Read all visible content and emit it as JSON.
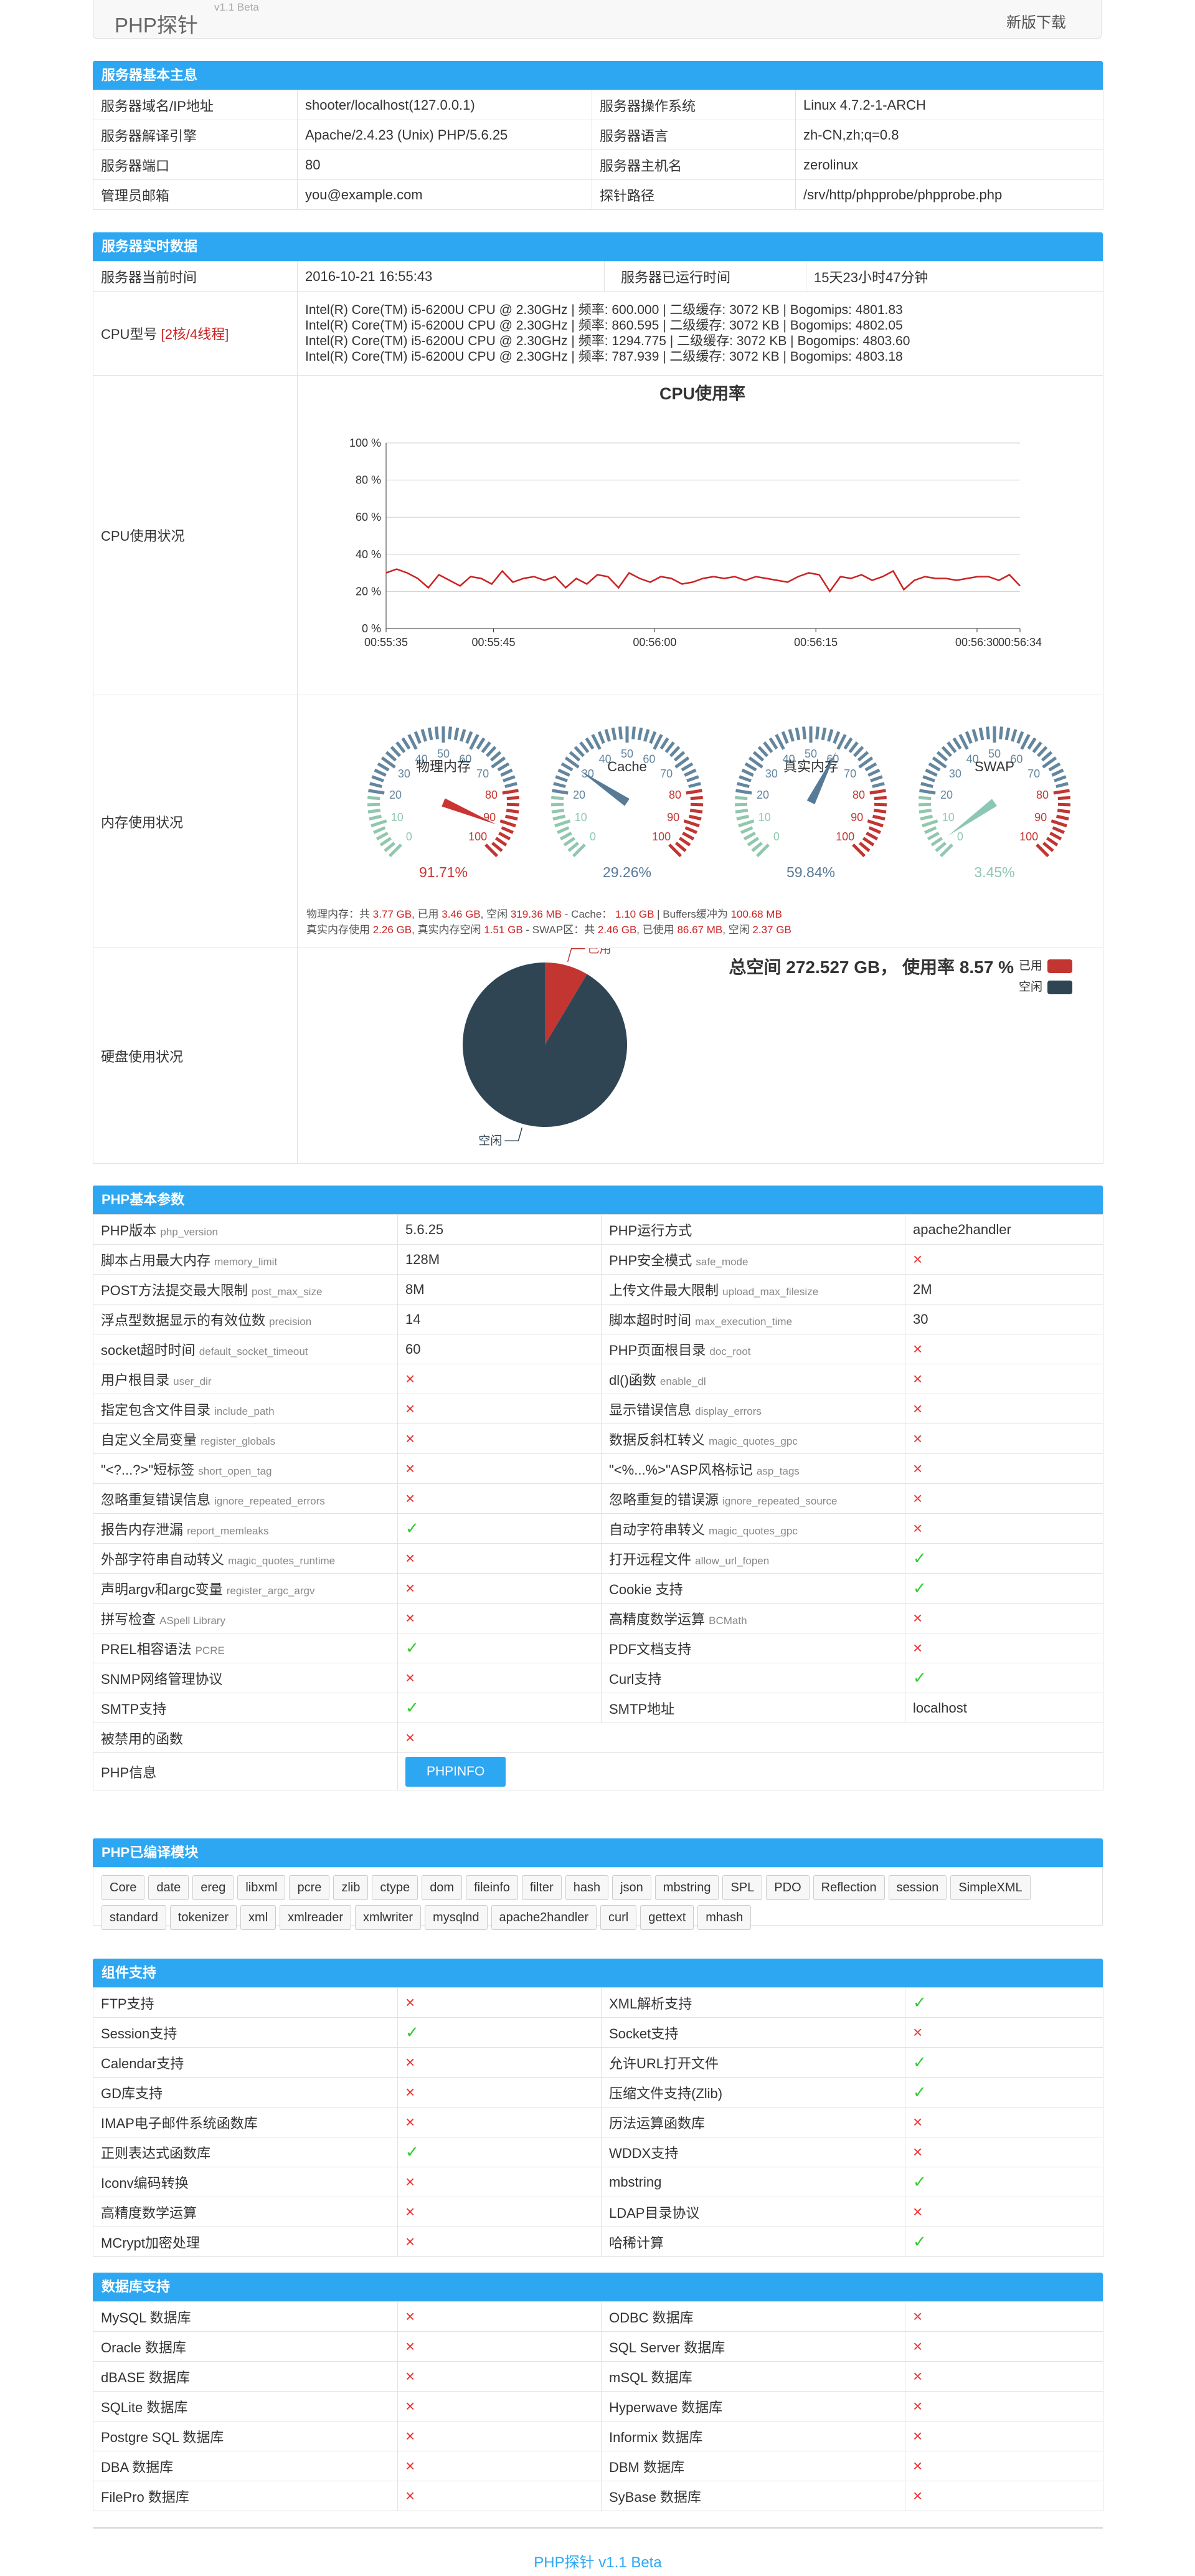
{
  "nav": {
    "brand": "PHP探针",
    "version": "v1.1 Beta",
    "download": "新版下载"
  },
  "server_info": {
    "title": "服务器基本主息",
    "rows": [
      [
        "服务器域名/IP地址",
        "shooter/localhost(127.0.0.1)",
        "服务器操作系统",
        "Linux 4.7.2-1-ARCH"
      ],
      [
        "服务器解译引擎",
        "Apache/2.4.23 (Unix) PHP/5.6.25",
        "服务器语言",
        "zh-CN,zh;q=0.8"
      ],
      [
        "服务器端口",
        "80",
        "服务器主机名",
        "zerolinux"
      ],
      [
        "管理员邮箱",
        "you@example.com",
        "探针路径",
        "/srv/http/phpprobe/phpprobe.php"
      ]
    ]
  },
  "realtime": {
    "title": "服务器实时数据",
    "time_label": "服务器当前时间",
    "time_value": "2016-10-21 16:55:43",
    "uptime_label": "服务器已运行时间",
    "uptime_value": "15天23小时47分钟",
    "cpu_label": "CPU型号",
    "cpu_cores": "[2核/4线程]",
    "cpu_lines": [
      "Intel(R) Core(TM) i5-6200U CPU @ 2.30GHz | 频率: 600.000 | 二级缓存: 3072 KB | Bogomips: 4801.83",
      "Intel(R) Core(TM) i5-6200U CPU @ 2.30GHz | 频率: 860.595 | 二级缓存: 3072 KB | Bogomips: 4802.05",
      "Intel(R) Core(TM) i5-6200U CPU @ 2.30GHz | 频率: 1294.775 | 二级缓存: 3072 KB | Bogomips: 4803.60",
      "Intel(R) Core(TM) i5-6200U CPU @ 2.30GHz | 频率: 787.939 | 二级缓存: 3072 KB | Bogomips: 4803.18"
    ],
    "cpu_usage_label": "CPU使用状况",
    "mem_usage_label": "内存使用状况",
    "disk_usage_label": "硬盘使用状况",
    "mem_line1": {
      "a": "物理内存：共 ",
      "b": "3.77 GB",
      "c": ", 已用 ",
      "d": "3.46 GB",
      "e": ", 空闲 ",
      "f": "319.36 MB",
      "g": " - Cache：  ",
      "h": "1.10 GB",
      "i": " | Buffers缓冲为 ",
      "j": "100.68 MB"
    },
    "mem_line2": {
      "a": "真实内存使用 ",
      "b": "2.26 GB",
      "c": ", 真实内存空闲 ",
      "d": "1.51 GB",
      "e": " - SWAP区：共 ",
      "f": "2.46 GB",
      "g": ", 已使用 ",
      "h": "86.67 MB",
      "i": ", 空闲 ",
      "j": "2.37 GB"
    }
  },
  "chart_data": [
    {
      "type": "line",
      "title": "CPU使用率",
      "x_ticks": [
        "00:55:35",
        "00:55:45",
        "00:56:00",
        "00:56:15",
        "00:56:30",
        "00:56:34"
      ],
      "y_ticks": [
        "0 %",
        "20 %",
        "40 %",
        "60 %",
        "80 %",
        "100 %"
      ],
      "ylim": [
        0,
        100
      ],
      "xlim": [
        "00:55:35",
        "00:56:34"
      ],
      "grid": true,
      "color": "#cc2222",
      "series": [
        {
          "values": [
            30,
            32,
            30,
            27,
            22,
            29,
            26,
            23,
            28,
            27,
            24,
            31,
            25,
            27,
            28,
            26,
            28,
            22,
            27,
            24,
            29,
            28,
            22,
            30,
            27,
            25,
            28,
            27,
            24,
            25,
            27,
            28,
            27,
            28,
            26,
            28,
            27,
            26,
            25,
            28,
            30,
            29,
            20,
            28,
            27,
            29,
            26,
            28,
            31,
            21,
            26,
            28,
            27,
            27,
            26,
            27,
            28,
            28,
            26,
            29,
            23
          ]
        }
      ]
    },
    {
      "type": "gauge",
      "gauges": [
        {
          "name": "物理内存",
          "value": 91.71,
          "label": "91.71%",
          "color": "#cc3333"
        },
        {
          "name": "Cache",
          "value": 29.26,
          "label": "29.26%",
          "color": "#577a97"
        },
        {
          "name": "真实内存",
          "value": 59.84,
          "label": "59.84%",
          "color": "#577a97"
        },
        {
          "name": "SWAP",
          "value": 3.45,
          "label": "3.45%",
          "color": "#8cc7b5"
        }
      ],
      "ticks": [
        "0",
        "10",
        "20",
        "30",
        "40",
        "50",
        "60",
        "70",
        "80",
        "90",
        "100"
      ]
    },
    {
      "type": "pie",
      "title": "总空间 272.527 GB， 使用率 8.57 %",
      "slices": [
        {
          "name": "已用",
          "value": 8.57,
          "color": "#c23531"
        },
        {
          "name": "空闲",
          "value": 91.43,
          "color": "#2f4554"
        }
      ],
      "legend_position": "top-right"
    }
  ],
  "php_basic": {
    "title": "PHP基本参数",
    "rows": [
      [
        [
          "PHP版本 ",
          "php_version"
        ],
        [
          "5.6.25",
          ""
        ],
        [
          "PHP运行方式",
          ""
        ],
        [
          "apache2handler",
          ""
        ]
      ],
      [
        [
          "脚本占用最大内存 ",
          "memory_limit"
        ],
        [
          "128M",
          ""
        ],
        [
          "PHP安全模式 ",
          "safe_mode"
        ],
        [
          "×",
          "x"
        ]
      ],
      [
        [
          "POST方法提交最大限制 ",
          "post_max_size"
        ],
        [
          "8M",
          ""
        ],
        [
          "上传文件最大限制 ",
          "upload_max_filesize"
        ],
        [
          "2M",
          ""
        ]
      ],
      [
        [
          "浮点型数据显示的有效位数 ",
          "precision"
        ],
        [
          "14",
          ""
        ],
        [
          "脚本超时时间 ",
          "max_execution_time"
        ],
        [
          "30",
          ""
        ]
      ],
      [
        [
          "socket超时时间 ",
          "default_socket_timeout"
        ],
        [
          "60",
          ""
        ],
        [
          "PHP页面根目录 ",
          "doc_root"
        ],
        [
          "×",
          "x"
        ]
      ],
      [
        [
          "用户根目录 ",
          "user_dir"
        ],
        [
          "×",
          "x"
        ],
        [
          "dl()函数 ",
          "enable_dl"
        ],
        [
          "×",
          "x"
        ]
      ],
      [
        [
          "指定包含文件目录 ",
          "include_path"
        ],
        [
          "×",
          "x"
        ],
        [
          "显示错误信息 ",
          "display_errors"
        ],
        [
          "×",
          "x"
        ]
      ],
      [
        [
          "自定义全局变量 ",
          "register_globals"
        ],
        [
          "×",
          "x"
        ],
        [
          "数据反斜杠转义 ",
          "magic_quotes_gpc"
        ],
        [
          "×",
          "x"
        ]
      ],
      [
        [
          "\"<?...?>\"短标签 ",
          "short_open_tag"
        ],
        [
          "×",
          "x"
        ],
        [
          "\"<%...%>\"ASP风格标记 ",
          "asp_tags"
        ],
        [
          "×",
          "x"
        ]
      ],
      [
        [
          "忽略重复错误信息 ",
          "ignore_repeated_errors"
        ],
        [
          "×",
          "x"
        ],
        [
          "忽略重复的错误源 ",
          "ignore_repeated_source"
        ],
        [
          "×",
          "x"
        ]
      ],
      [
        [
          "报告内存泄漏 ",
          "report_memleaks"
        ],
        [
          "✓",
          "ok"
        ],
        [
          "自动字符串转义 ",
          "magic_quotes_gpc"
        ],
        [
          "×",
          "x"
        ]
      ],
      [
        [
          "外部字符串自动转义 ",
          "magic_quotes_runtime"
        ],
        [
          "×",
          "x"
        ],
        [
          "打开远程文件 ",
          "allow_url_fopen"
        ],
        [
          "✓",
          "ok"
        ]
      ],
      [
        [
          "声明argv和argc变量 ",
          "register_argc_argv"
        ],
        [
          "×",
          "x"
        ],
        [
          "Cookie 支持",
          ""
        ],
        [
          "✓",
          "ok"
        ]
      ],
      [
        [
          "拼写检查 ",
          "ASpell Library"
        ],
        [
          "×",
          "x"
        ],
        [
          "高精度数学运算 ",
          "BCMath"
        ],
        [
          "×",
          "x"
        ]
      ],
      [
        [
          "PREL相容语法 ",
          "PCRE"
        ],
        [
          "✓",
          "ok"
        ],
        [
          "PDF文档支持",
          ""
        ],
        [
          "×",
          "x"
        ]
      ],
      [
        [
          "SNMP网络管理协议",
          ""
        ],
        [
          "×",
          "x"
        ],
        [
          "Curl支持",
          ""
        ],
        [
          "✓",
          "ok"
        ]
      ],
      [
        [
          "SMTP支持",
          ""
        ],
        [
          "✓",
          "ok"
        ],
        [
          "SMTP地址",
          ""
        ],
        [
          "localhost",
          ""
        ]
      ]
    ],
    "disabled_label": "被禁用的函数",
    "disabled_value": "×",
    "phpinfo_label": "PHP信息",
    "phpinfo_button": "PHPINFO"
  },
  "modules": {
    "title": "PHP已编译模块",
    "items": [
      "Core",
      "date",
      "ereg",
      "libxml",
      "pcre",
      "zlib",
      "ctype",
      "dom",
      "fileinfo",
      "filter",
      "hash",
      "json",
      "mbstring",
      "SPL",
      "PDO",
      "Reflection",
      "session",
      "SimpleXML",
      "standard",
      "tokenizer",
      "xml",
      "xmlreader",
      "xmlwriter",
      "mysqlnd",
      "apache2handler",
      "curl",
      "gettext",
      "mhash"
    ]
  },
  "components": {
    "title": "组件支持",
    "rows": [
      [
        "FTP支持",
        "x",
        "XML解析支持",
        "ok"
      ],
      [
        "Session支持",
        "ok",
        "Socket支持",
        "x"
      ],
      [
        "Calendar支持",
        "x",
        "允许URL打开文件",
        "ok"
      ],
      [
        "GD库支持",
        "x",
        "压缩文件支持(Zlib)",
        "ok"
      ],
      [
        "IMAP电子邮件系统函数库",
        "x",
        "历法运算函数库",
        "x"
      ],
      [
        "正则表达式函数库",
        "ok",
        "WDDX支持",
        "x"
      ],
      [
        "Iconv编码转换",
        "x",
        "mbstring",
        "ok"
      ],
      [
        "高精度数学运算",
        "x",
        "LDAP目录协议",
        "x"
      ],
      [
        "MCrypt加密处理",
        "x",
        "哈稀计算",
        "ok"
      ]
    ]
  },
  "databases": {
    "title": "数据库支持",
    "rows": [
      [
        "MySQL 数据库",
        "x",
        "ODBC 数据库",
        "x"
      ],
      [
        "Oracle 数据库",
        "x",
        "SQL Server 数据库",
        "x"
      ],
      [
        "dBASE 数据库",
        "x",
        "mSQL 数据库",
        "x"
      ],
      [
        "SQLite 数据库",
        "x",
        "Hyperwave 数据库",
        "x"
      ],
      [
        "Postgre SQL 数据库",
        "x",
        "Informix 数据库",
        "x"
      ],
      [
        "DBA 数据库",
        "x",
        "DBM 数据库",
        "x"
      ],
      [
        "FilePro 数据库",
        "x",
        "SyBase 数据库",
        "x"
      ]
    ]
  },
  "footer": {
    "text": "PHP探针 v1.1 Beta"
  },
  "icons": {
    "yes": "✓",
    "no": "×"
  }
}
